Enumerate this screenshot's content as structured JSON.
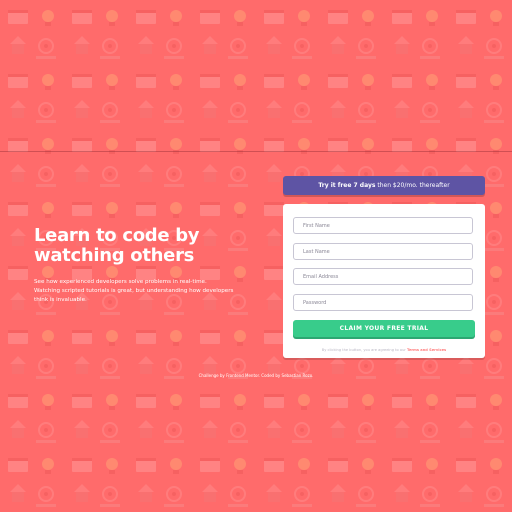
{
  "colors": {
    "background": "#ff6b6b",
    "promo_bg": "#5e54a4",
    "cta_bg": "#38cc8b",
    "link": "#ff7a7a"
  },
  "hero": {
    "title": "Learn to code by watching others",
    "text": "See how experienced developers solve problems in real-time. Watching scripted tutorials is great, but understanding how developers think is invaluable."
  },
  "promo": {
    "strong": "Try it free 7 days",
    "rest": " then $20/mo. thereafter"
  },
  "form": {
    "first_name_placeholder": "First Name",
    "last_name_placeholder": "Last Name",
    "email_placeholder": "Email Address",
    "password_placeholder": "Password",
    "cta_label": "CLAIM YOUR FREE TRIAL",
    "terms_prefix": "By clicking the button, you are agreeing to our ",
    "terms_link": "Terms and Services"
  },
  "footer": {
    "prefix": "Challenge by ",
    "fm_link": "Frontend Mentor",
    "middle": ". Coded by ",
    "author_link": "Sebastian Rozo",
    "suffix": "."
  }
}
